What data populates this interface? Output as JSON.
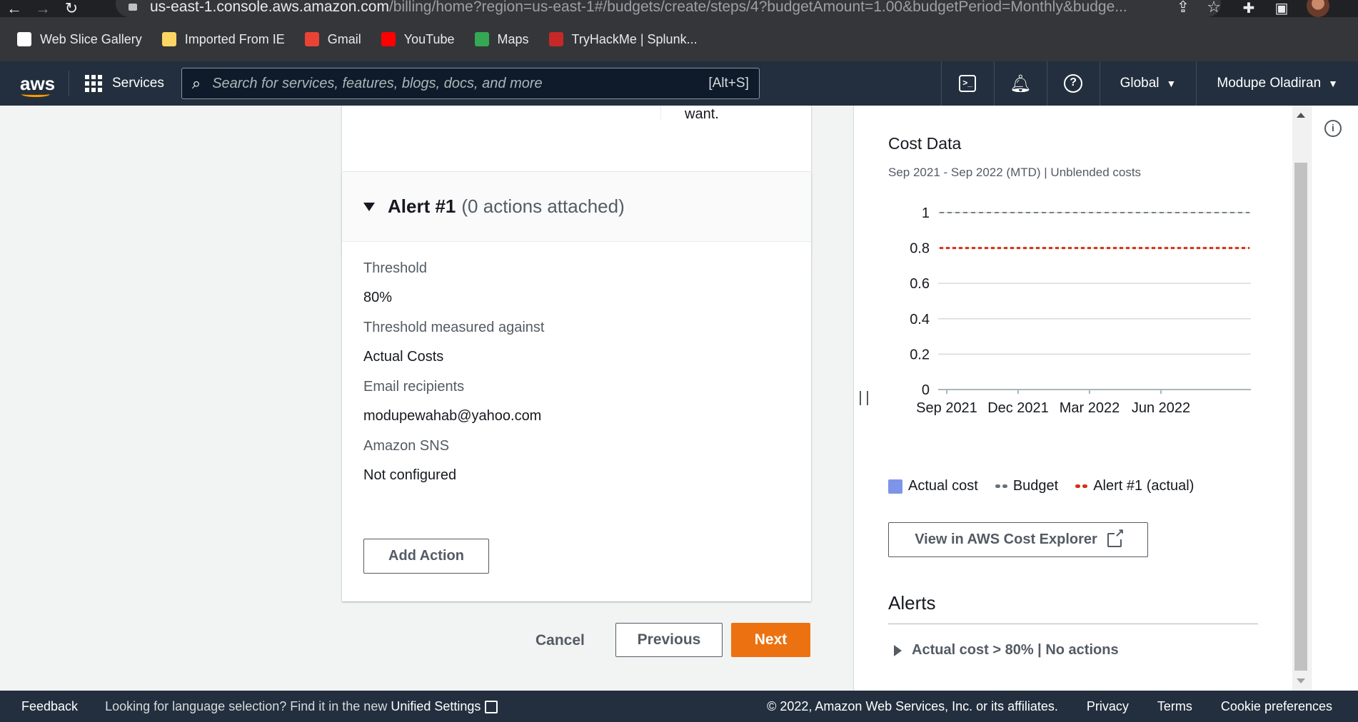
{
  "browser": {
    "url_host": "us-east-1.console.aws.amazon.com",
    "url_path": "/billing/home?region=us-east-1#/budgets/create/steps/4?budgetAmount=1.00&budgetPeriod=Monthly&budge...",
    "bookmarks": [
      {
        "label": "Web Slice Gallery",
        "color": "#ffffff"
      },
      {
        "label": "Imported From IE",
        "color": "#fdd663"
      },
      {
        "label": "Gmail",
        "color": "#ea4335"
      },
      {
        "label": "YouTube",
        "color": "#ff0000"
      },
      {
        "label": "Maps",
        "color": "#34a853"
      },
      {
        "label": "TryHackMe | Splunk...",
        "color": "#c62828"
      }
    ]
  },
  "awsnav": {
    "logo": "aws",
    "services_label": "Services",
    "search_placeholder": "Search for services, features, blogs, docs, and more",
    "search_shortcut": "[Alt+S]",
    "region": "Global",
    "user": "Modupe Oladiran"
  },
  "top_card": {
    "trailing_text": "want."
  },
  "alert": {
    "title": "Alert #1",
    "subtitle": "(0 actions attached)",
    "threshold_label": "Threshold",
    "threshold_value": "80%",
    "measured_label": "Threshold measured against",
    "measured_value": "Actual Costs",
    "email_label": "Email recipients",
    "email_value": "modupewahab@yahoo.com",
    "sns_label": "Amazon SNS",
    "sns_value": "Not configured",
    "add_action_label": "Add Action"
  },
  "wizard": {
    "cancel_label": "Cancel",
    "previous_label": "Previous",
    "next_label": "Next"
  },
  "side_panel": {
    "cost_title": "Cost Data",
    "cost_subtitle": "Sep 2021 - Sep 2022 (MTD) | Unblended costs",
    "explorer_button": "View in AWS Cost Explorer",
    "alerts_title": "Alerts",
    "alert_summary": "Actual cost > 80% | No actions"
  },
  "chart_data": {
    "type": "line",
    "title": "Cost Data",
    "subtitle": "Sep 2021 - Sep 2022 (MTD) | Unblended costs",
    "x_ticks": [
      "Sep 2021",
      "Dec 2021",
      "Mar 2022",
      "Jun 2022"
    ],
    "y_ticks": [
      0,
      0.2,
      0.4,
      0.6,
      0.8,
      1
    ],
    "ylim": [
      0,
      1
    ],
    "grid": true,
    "legend_position": "bottom",
    "series": [
      {
        "name": "Actual cost",
        "kind": "bar",
        "color": "#7d94e9",
        "values": []
      },
      {
        "name": "Budget",
        "kind": "dashed-line",
        "color": "#687078",
        "value": 1
      },
      {
        "name": "Alert #1 (actual)",
        "kind": "dashed-line",
        "color": "#d13212",
        "value": 0.8
      }
    ]
  },
  "footer": {
    "feedback": "Feedback",
    "lang_prefix": "Looking for language selection? Find it in the new",
    "lang_link": "Unified Settings",
    "copyright": "© 2022, Amazon Web Services, Inc. or its affiliates.",
    "privacy": "Privacy",
    "terms": "Terms",
    "cookies": "Cookie preferences"
  }
}
